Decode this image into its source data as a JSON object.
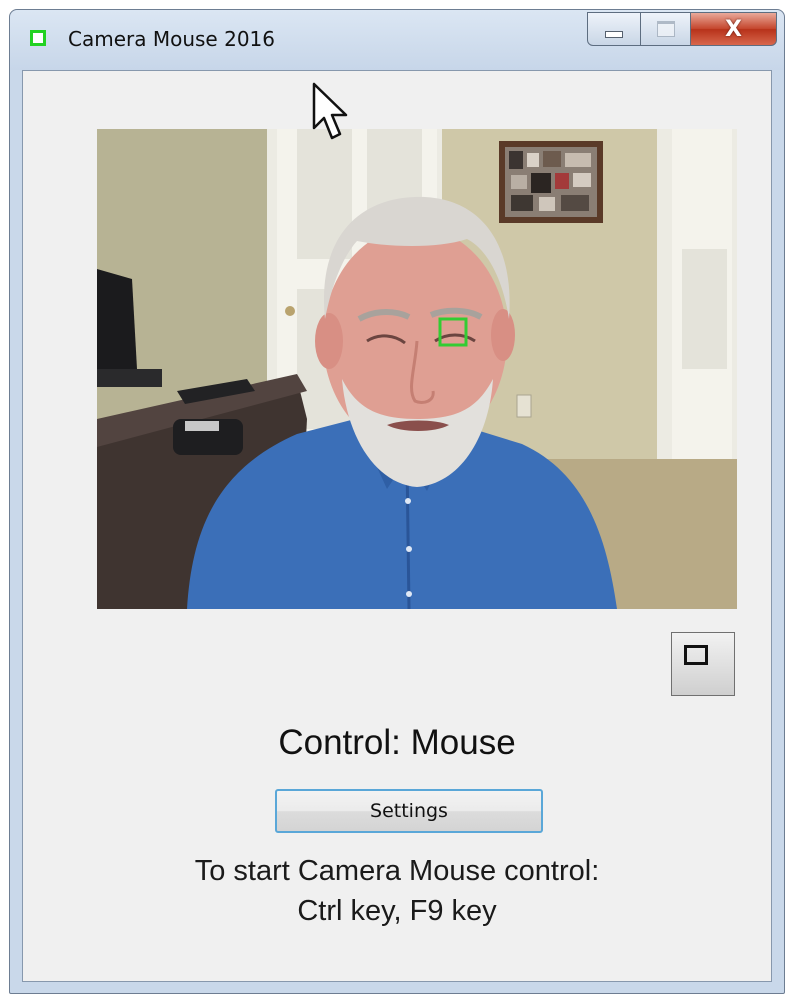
{
  "window": {
    "title": "Camera Mouse 2016",
    "icon": "green-square-icon",
    "caption_buttons": [
      "minimize-icon",
      "maximize-icon",
      "close-icon"
    ],
    "close_glyph": "X"
  },
  "video": {
    "tracking_box_color": "#33cc33"
  },
  "main": {
    "control_status": "Control: Mouse",
    "settings_label": "Settings",
    "instruction_line1": "To start Camera Mouse control:",
    "instruction_line2": "Ctrl key, F9 key"
  },
  "colors": {
    "accent_green": "#22d222",
    "button_focus_border": "#5aa7d8",
    "close_button": "#c4442b"
  }
}
